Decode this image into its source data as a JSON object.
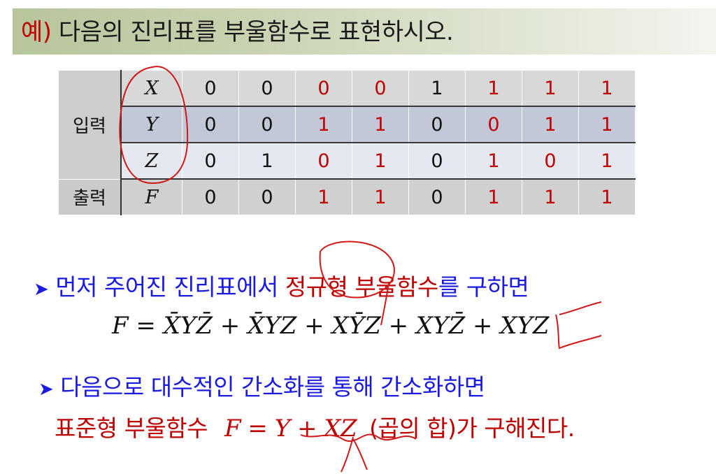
{
  "title": {
    "example": "예)",
    "text": "다음의 진리표를 부울함수로 표현하시오."
  },
  "truth_table": {
    "input_group": "입력",
    "output_group": "출력",
    "rows": [
      {
        "var": "X",
        "values": [
          "0",
          "0",
          "0",
          "0",
          "1",
          "1",
          "1",
          "1"
        ]
      },
      {
        "var": "Y",
        "values": [
          "0",
          "0",
          "1",
          "1",
          "0",
          "0",
          "1",
          "1"
        ]
      },
      {
        "var": "Z",
        "values": [
          "0",
          "1",
          "0",
          "1",
          "0",
          "1",
          "0",
          "1"
        ]
      },
      {
        "var": "F",
        "values": [
          "0",
          "0",
          "1",
          "1",
          "0",
          "1",
          "1",
          "1"
        ]
      }
    ],
    "red_columns": [
      2,
      3,
      5,
      6,
      7
    ]
  },
  "bullet1": {
    "prefix": "먼저 주어진 진리표에서 ",
    "highlight": "정규형 부울함수",
    "suffix": "를 구하면"
  },
  "equation1": {
    "lhs": "F",
    "terms": [
      "X̄YZ̄",
      "X̄YZ",
      "XȲZ",
      "XYZ̄",
      "XYZ"
    ]
  },
  "bullet2": {
    "text": "다음으로 대수적인 간소화를 통해 간소화하면"
  },
  "line3": {
    "lead": "표준형 부울함수",
    "lhs": "F",
    "rhs": "Y + XZ",
    "paren": "(곱의 합)",
    "tail": "가 구해진다."
  },
  "colors": {
    "red": "#c00000",
    "blue": "#1a1ae0",
    "title_bar": "#b7c59b"
  }
}
